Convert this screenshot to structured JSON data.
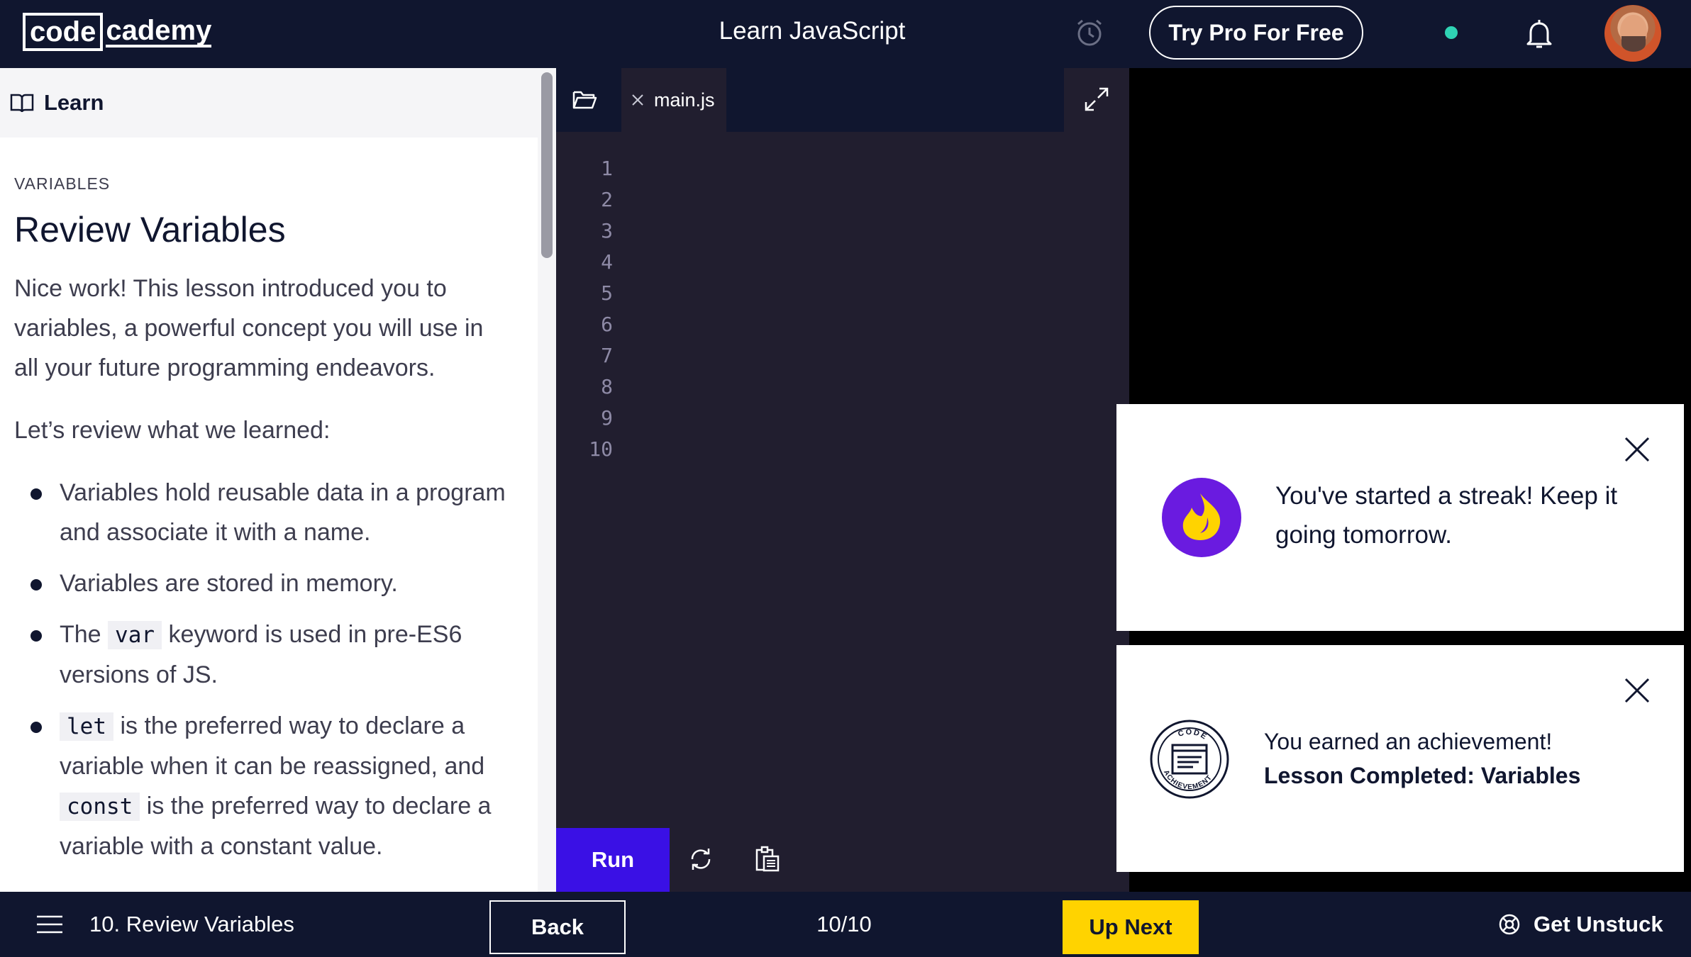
{
  "header": {
    "logo_code": "code",
    "logo_rest": "cademy",
    "course_title": "Learn JavaScript",
    "try_pro_label": "Try Pro For Free",
    "icons": [
      "alarm-clock-icon",
      "bell-icon"
    ],
    "status_dot_color": "#2fd3b4"
  },
  "learn": {
    "header_label": "Learn",
    "section": "VARIABLES",
    "title": "Review Variables",
    "intro": "Nice work! This lesson introduced you to variables, a powerful concept you will use in all your future programming endeavors.",
    "review_intro": "Let’s review what we learned:",
    "bullets": [
      {
        "text": "Variables hold reusable data in a program and associate it with a name."
      },
      {
        "text": "Variables are stored in memory."
      },
      {
        "before": "The ",
        "code": "var",
        "after": " keyword is used in pre-ES6 versions of JS."
      },
      {
        "code": "let",
        "after": " is the preferred way to declare a variable when it can be reassigned, and ",
        "code2": "const",
        "after2": " is the preferred way to declare a variable with a constant value."
      }
    ]
  },
  "editor": {
    "file_tab": "main.js",
    "line_numbers": [
      "1",
      "2",
      "3",
      "4",
      "5",
      "6",
      "7",
      "8",
      "9",
      "10"
    ],
    "run_label": "Run"
  },
  "toasts": {
    "streak": "You've started a streak! Keep it going tomorrow.",
    "achievement_line1": "You earned an achievement!",
    "achievement_line2": "Lesson Completed: Variables",
    "badge_text_top": "CODE",
    "badge_text_bottom": "ACHIEVEMENT"
  },
  "footer": {
    "lesson": "10. Review Variables",
    "back_label": "Back",
    "progress": "10/10",
    "next_label": "Up Next",
    "unstuck_label": "Get Unstuck"
  },
  "colors": {
    "nav_bg": "#10162f",
    "editor_bg": "#211e2f",
    "run_button": "#3a10e5",
    "next_button": "#ffd300",
    "streak_badge": "#6a1be0"
  }
}
